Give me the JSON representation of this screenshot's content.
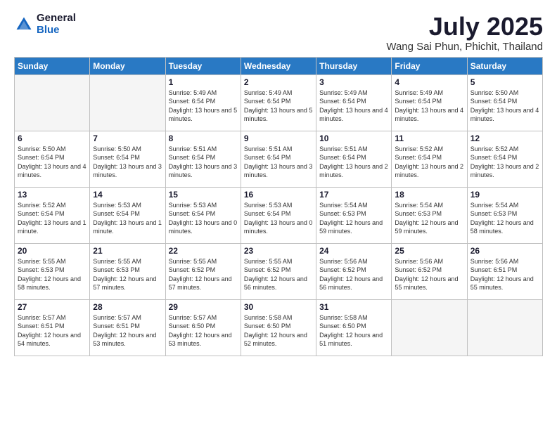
{
  "logo": {
    "general": "General",
    "blue": "Blue"
  },
  "title": "July 2025",
  "subtitle": "Wang Sai Phun, Phichit, Thailand",
  "weekdays": [
    "Sunday",
    "Monday",
    "Tuesday",
    "Wednesday",
    "Thursday",
    "Friday",
    "Saturday"
  ],
  "weeks": [
    [
      {
        "day": "",
        "info": "",
        "empty": true
      },
      {
        "day": "",
        "info": "",
        "empty": true
      },
      {
        "day": "1",
        "info": "Sunrise: 5:49 AM\nSunset: 6:54 PM\nDaylight: 13 hours and 5 minutes."
      },
      {
        "day": "2",
        "info": "Sunrise: 5:49 AM\nSunset: 6:54 PM\nDaylight: 13 hours and 5 minutes."
      },
      {
        "day": "3",
        "info": "Sunrise: 5:49 AM\nSunset: 6:54 PM\nDaylight: 13 hours and 4 minutes."
      },
      {
        "day": "4",
        "info": "Sunrise: 5:49 AM\nSunset: 6:54 PM\nDaylight: 13 hours and 4 minutes."
      },
      {
        "day": "5",
        "info": "Sunrise: 5:50 AM\nSunset: 6:54 PM\nDaylight: 13 hours and 4 minutes."
      }
    ],
    [
      {
        "day": "6",
        "info": "Sunrise: 5:50 AM\nSunset: 6:54 PM\nDaylight: 13 hours and 4 minutes."
      },
      {
        "day": "7",
        "info": "Sunrise: 5:50 AM\nSunset: 6:54 PM\nDaylight: 13 hours and 3 minutes."
      },
      {
        "day": "8",
        "info": "Sunrise: 5:51 AM\nSunset: 6:54 PM\nDaylight: 13 hours and 3 minutes."
      },
      {
        "day": "9",
        "info": "Sunrise: 5:51 AM\nSunset: 6:54 PM\nDaylight: 13 hours and 3 minutes."
      },
      {
        "day": "10",
        "info": "Sunrise: 5:51 AM\nSunset: 6:54 PM\nDaylight: 13 hours and 2 minutes."
      },
      {
        "day": "11",
        "info": "Sunrise: 5:52 AM\nSunset: 6:54 PM\nDaylight: 13 hours and 2 minutes."
      },
      {
        "day": "12",
        "info": "Sunrise: 5:52 AM\nSunset: 6:54 PM\nDaylight: 13 hours and 2 minutes."
      }
    ],
    [
      {
        "day": "13",
        "info": "Sunrise: 5:52 AM\nSunset: 6:54 PM\nDaylight: 13 hours and 1 minute."
      },
      {
        "day": "14",
        "info": "Sunrise: 5:53 AM\nSunset: 6:54 PM\nDaylight: 13 hours and 1 minute."
      },
      {
        "day": "15",
        "info": "Sunrise: 5:53 AM\nSunset: 6:54 PM\nDaylight: 13 hours and 0 minutes."
      },
      {
        "day": "16",
        "info": "Sunrise: 5:53 AM\nSunset: 6:54 PM\nDaylight: 13 hours and 0 minutes."
      },
      {
        "day": "17",
        "info": "Sunrise: 5:54 AM\nSunset: 6:53 PM\nDaylight: 12 hours and 59 minutes."
      },
      {
        "day": "18",
        "info": "Sunrise: 5:54 AM\nSunset: 6:53 PM\nDaylight: 12 hours and 59 minutes."
      },
      {
        "day": "19",
        "info": "Sunrise: 5:54 AM\nSunset: 6:53 PM\nDaylight: 12 hours and 58 minutes."
      }
    ],
    [
      {
        "day": "20",
        "info": "Sunrise: 5:55 AM\nSunset: 6:53 PM\nDaylight: 12 hours and 58 minutes."
      },
      {
        "day": "21",
        "info": "Sunrise: 5:55 AM\nSunset: 6:53 PM\nDaylight: 12 hours and 57 minutes."
      },
      {
        "day": "22",
        "info": "Sunrise: 5:55 AM\nSunset: 6:52 PM\nDaylight: 12 hours and 57 minutes."
      },
      {
        "day": "23",
        "info": "Sunrise: 5:55 AM\nSunset: 6:52 PM\nDaylight: 12 hours and 56 minutes."
      },
      {
        "day": "24",
        "info": "Sunrise: 5:56 AM\nSunset: 6:52 PM\nDaylight: 12 hours and 56 minutes."
      },
      {
        "day": "25",
        "info": "Sunrise: 5:56 AM\nSunset: 6:52 PM\nDaylight: 12 hours and 55 minutes."
      },
      {
        "day": "26",
        "info": "Sunrise: 5:56 AM\nSunset: 6:51 PM\nDaylight: 12 hours and 55 minutes."
      }
    ],
    [
      {
        "day": "27",
        "info": "Sunrise: 5:57 AM\nSunset: 6:51 PM\nDaylight: 12 hours and 54 minutes."
      },
      {
        "day": "28",
        "info": "Sunrise: 5:57 AM\nSunset: 6:51 PM\nDaylight: 12 hours and 53 minutes."
      },
      {
        "day": "29",
        "info": "Sunrise: 5:57 AM\nSunset: 6:50 PM\nDaylight: 12 hours and 53 minutes."
      },
      {
        "day": "30",
        "info": "Sunrise: 5:58 AM\nSunset: 6:50 PM\nDaylight: 12 hours and 52 minutes."
      },
      {
        "day": "31",
        "info": "Sunrise: 5:58 AM\nSunset: 6:50 PM\nDaylight: 12 hours and 51 minutes."
      },
      {
        "day": "",
        "info": "",
        "empty": true
      },
      {
        "day": "",
        "info": "",
        "empty": true
      }
    ]
  ]
}
